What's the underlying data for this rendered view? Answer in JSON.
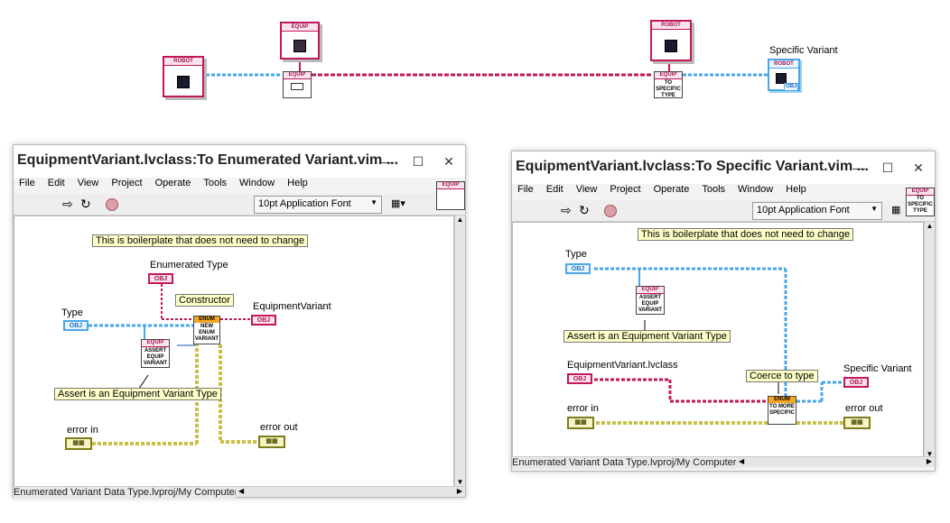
{
  "top": {
    "robot_label": "ROBOT",
    "equip_label": "EQUIP",
    "to_specific": "TO SPECIFIC TYPE",
    "specific_variant_label": "Specific Variant",
    "obj_label": "OBJ"
  },
  "left_window": {
    "title": "EquipmentVariant.lvclass:To Enumerated Variant.vim ...",
    "menu": [
      "File",
      "Edit",
      "View",
      "Project",
      "Operate",
      "Tools",
      "Window",
      "Help"
    ],
    "font": "10pt Application Font",
    "icon_label": "EQUIP",
    "note_boilerplate": "This is boilerplate that does not need to change",
    "enumerated_type": "Enumerated Type",
    "constructor": "Constructor",
    "equipment_variant": "EquipmentVariant",
    "type": "Type",
    "assert_note": "Assert is an Equipment Variant Type",
    "error_in": "error in",
    "error_out": "error out",
    "obj": "OBJ",
    "enum_hdr": "ENUM",
    "enum_node": "NEW ENUM VARIANT",
    "assert_hdr": "EQUIP",
    "assert_node": "ASSERT EQUIP VARIANT",
    "status": "Enumerated Variant Data Type.lvproj/My Computer"
  },
  "right_window": {
    "title": "EquipmentVariant.lvclass:To Specific Variant.vim ...",
    "menu": [
      "File",
      "Edit",
      "View",
      "Project",
      "Operate",
      "Tools",
      "Window",
      "Help"
    ],
    "font": "10pt Application Font",
    "icon_label": "EQUIP",
    "icon_text": "TO SPECIFIC TYPE",
    "note_boilerplate": "This is boilerplate that does not need to change",
    "type": "Type",
    "assert_hdr": "EQUIP",
    "assert_node": "ASSERT EQUIP VARIANT",
    "assert_note": "Assert is an Equipment Variant Type",
    "equipment_variant_lvclass": "EquipmentVariant.lvclass",
    "coerce": "Coerce to type",
    "specific_variant": "Specific Variant",
    "error_in": "error in",
    "error_out": "error out",
    "obj": "OBJ",
    "enum_hdr": "ENUM",
    "enum_node": "TO MORE SPECIFIC",
    "status": "Enumerated Variant Data Type.lvproj/My Computer"
  },
  "colors": {
    "class_wire": "#c2185b",
    "variant_wire": "#49a6e8",
    "error_wire": "#c9c04a",
    "note_bg": "#ffffc8"
  }
}
